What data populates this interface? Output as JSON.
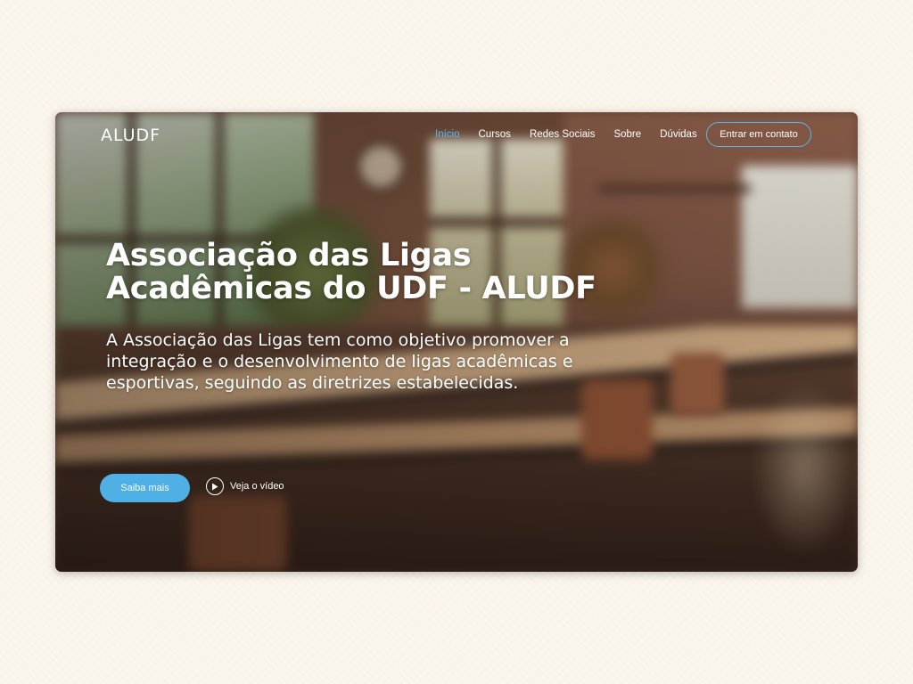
{
  "nav": {
    "logo": "ALUDF",
    "items": [
      {
        "label": "Início",
        "active": true
      },
      {
        "label": "Cursos",
        "active": false
      },
      {
        "label": "Redes Sociais",
        "active": false
      },
      {
        "label": "Sobre",
        "active": false
      },
      {
        "label": "Dúvidas",
        "active": false
      }
    ],
    "contact_label": "Entrar em contato"
  },
  "hero": {
    "title_line1": "Associação das Ligas",
    "title_line2": "Acadêmicas do UDF - ALUDF",
    "description": "A Associação das Ligas tem como objetivo promover a integração e o desenvolvimento de ligas acadêmicas e esportivas, seguindo as diretrizes estabelecidas.",
    "cta_label": "Saiba mais",
    "video_label": "Veja o vídeo",
    "video_icon": "play-icon"
  },
  "colors": {
    "accent": "#4fb0e6",
    "active_nav": "#58b7ea",
    "page_background": "#fbf6ec"
  }
}
